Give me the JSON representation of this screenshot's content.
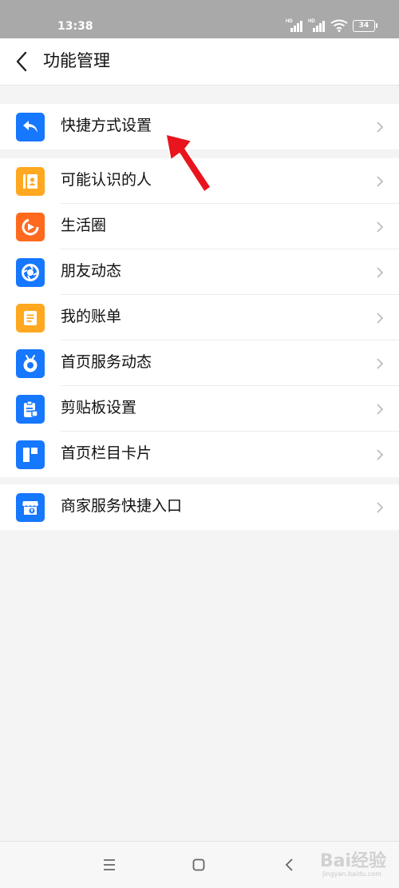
{
  "status_bar": {
    "time": "13:38",
    "signal_1_label": "HD",
    "signal_2_label": "HD",
    "battery": "34"
  },
  "header": {
    "title": "功能管理",
    "back_icon": "chevron-left-icon"
  },
  "groups": [
    {
      "items": [
        {
          "label": "快捷方式设置",
          "icon": "shortcut-arrow-icon",
          "color": "#1677ff"
        }
      ]
    },
    {
      "items": [
        {
          "label": "可能认识的人",
          "icon": "contact-book-icon",
          "color": "#ffa820"
        },
        {
          "label": "生活圈",
          "icon": "life-circle-icon",
          "color": "#ff6a1f"
        },
        {
          "label": "朋友动态",
          "icon": "aperture-icon",
          "color": "#1677ff"
        },
        {
          "label": "我的账单",
          "icon": "bill-icon",
          "color": "#ffa820"
        },
        {
          "label": "首页服务动态",
          "icon": "service-dynamic-icon",
          "color": "#1677ff"
        },
        {
          "label": "剪贴板设置",
          "icon": "clipboard-icon",
          "color": "#1677ff"
        },
        {
          "label": "首页栏目卡片",
          "icon": "layout-card-icon",
          "color": "#1677ff"
        }
      ]
    },
    {
      "items": [
        {
          "label": "商家服务快捷入口",
          "icon": "storefront-icon",
          "color": "#1677ff"
        }
      ]
    }
  ],
  "nav_bar": {
    "menu_icon": "menu-icon",
    "home_icon": "home-square-icon",
    "back_icon": "back-triangle-icon"
  },
  "watermark": {
    "text": "Bai经验",
    "sub": "jingyan.baidu.com"
  },
  "colors": {
    "accent_blue": "#1677ff",
    "accent_orange": "#ffa820",
    "arrow_red": "#e8141e",
    "background": "#f4f4f4"
  }
}
